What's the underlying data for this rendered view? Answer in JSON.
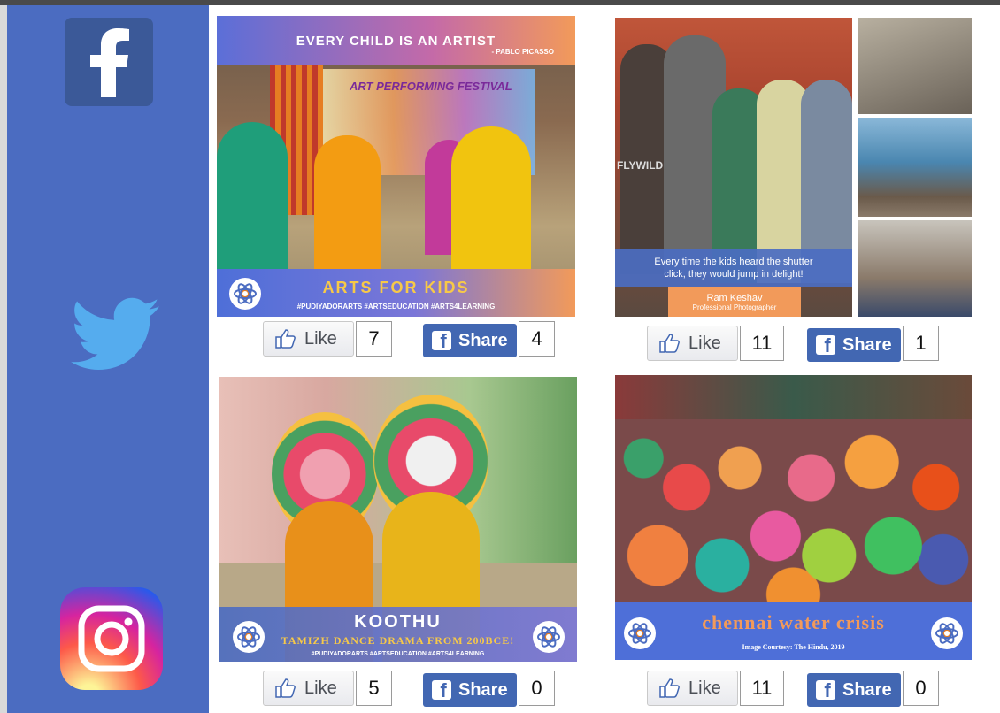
{
  "social": {
    "facebook": "facebook-icon",
    "twitter": "twitter-icon",
    "instagram": "instagram-icon"
  },
  "colors": {
    "sidebar": "#4b6cc1",
    "facebook": "#3b5998",
    "share": "#4267b2"
  },
  "posts": [
    {
      "banner_top": "EVERY CHILD IS AN ARTIST",
      "quote_author": "- PABLO PICASSO",
      "stage_sign": "ART PERFORMING FESTIVAL",
      "title": "ARTS FOR KIDS",
      "hashtags": "#PUDIYADORARTS #ARTSEDUCATION #ARTS4LEARNING",
      "like_label": "Like",
      "like_count": "7",
      "share_label": "Share",
      "share_count": "4"
    },
    {
      "shirt_text": "FLYWILD",
      "caption": "Every time the kids heard the shutter click, they would jump in delight!",
      "photographer": "Ram Keshav",
      "role": "Professional Photographer",
      "like_label": "Like",
      "like_count": "11",
      "share_label": "Share",
      "share_count": "1"
    },
    {
      "title": "KOOTHU",
      "subtitle": "TAMIZH DANCE DRAMA FROM 200BCE!",
      "hashtags": "#PUDIYADORARTS #ARTSEDUCATION #ARTS4LEARNING",
      "like_label": "Like",
      "like_count": "5",
      "share_label": "Share",
      "share_count": "0"
    },
    {
      "title": "chennai water crisis",
      "credit": "Image Courtesy: The Hindu, 2019",
      "like_label": "Like",
      "like_count": "11",
      "share_label": "Share",
      "share_count": "0"
    }
  ]
}
